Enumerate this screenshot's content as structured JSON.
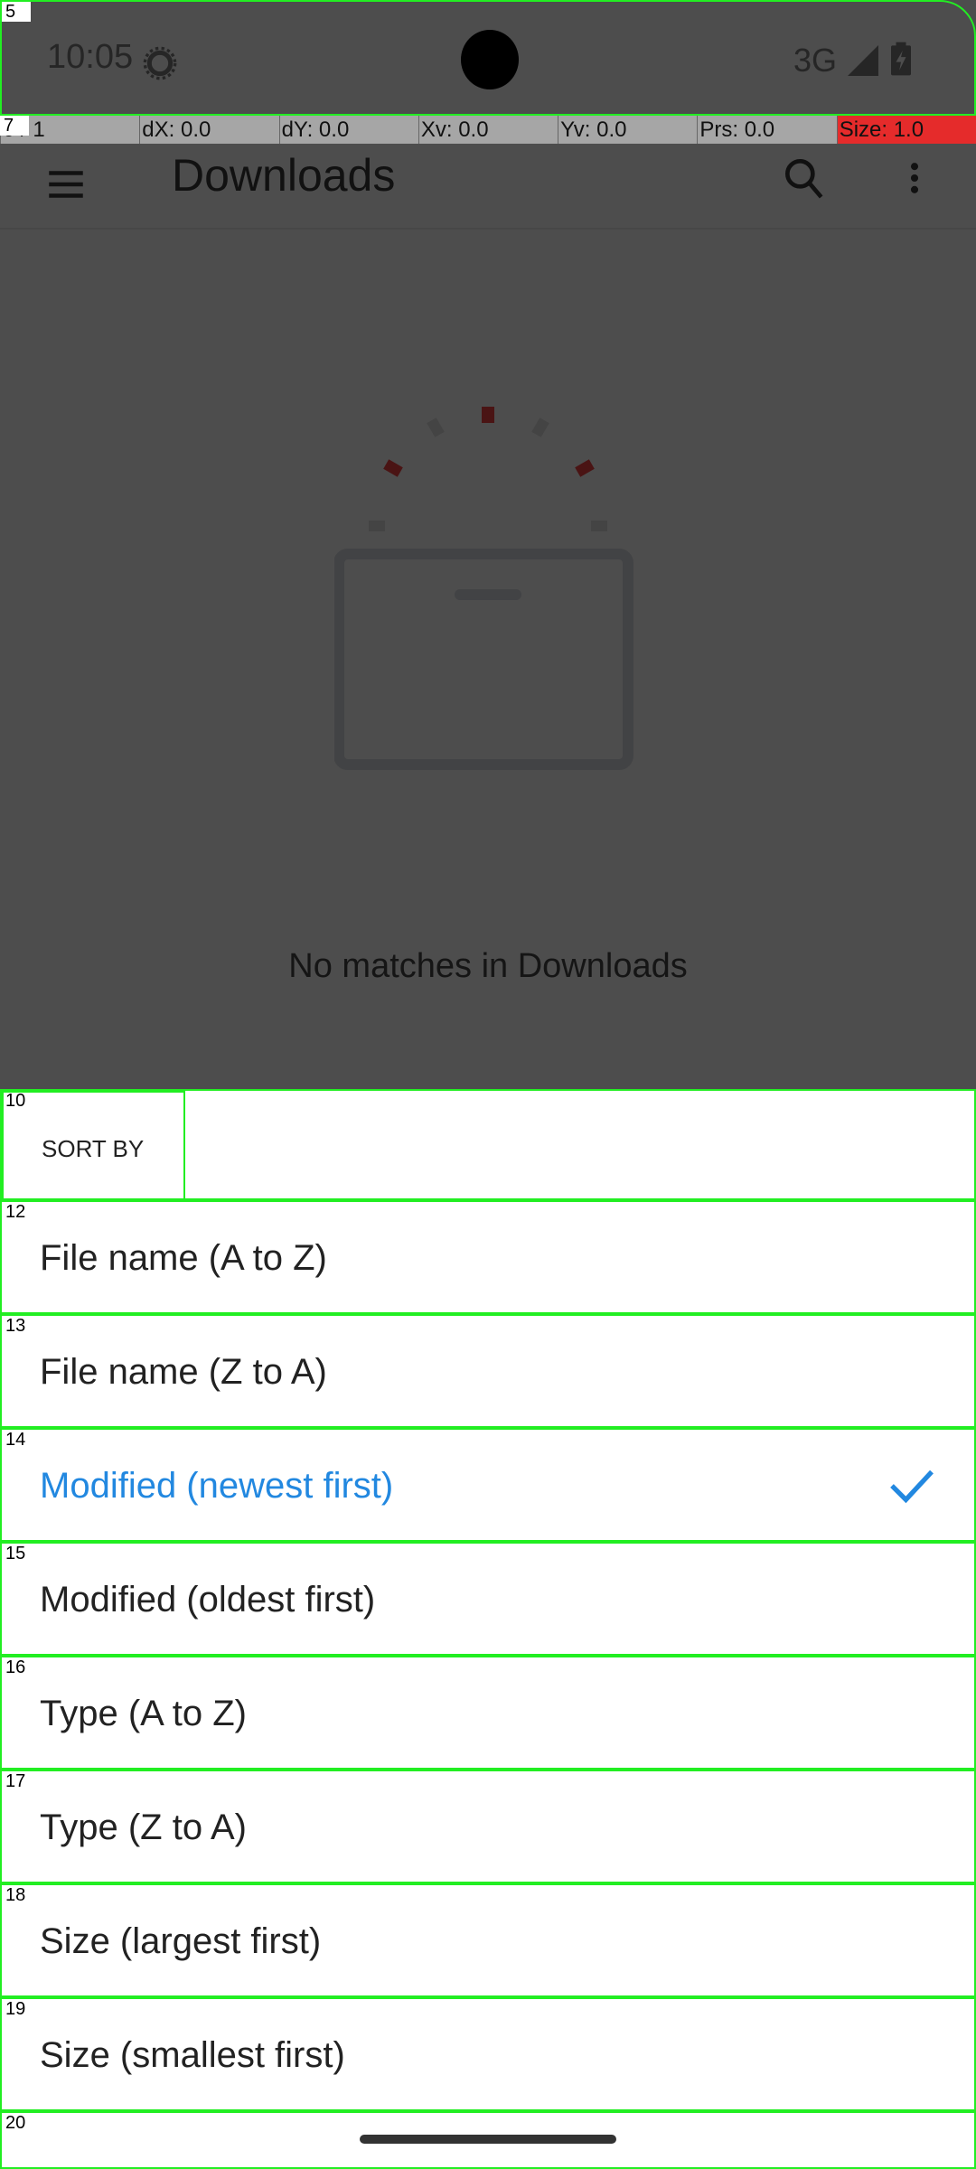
{
  "overlay_ids": [
    "5",
    "7",
    "10",
    "12",
    "13",
    "14",
    "15",
    "16",
    "17",
    "18",
    "19",
    "20"
  ],
  "status_bar": {
    "time": "10:05",
    "network": "3G",
    "icons": [
      "settings-gear-icon",
      "signal-icon",
      "battery-charging-icon"
    ]
  },
  "debug_bar": [
    "0 / 1",
    "dX: 0.0",
    "dY: 0.0",
    "Xv: 0.0",
    "Yv: 0.0",
    "Prs: 0.0",
    "Size: 1.0"
  ],
  "toolbar": {
    "title": "Downloads",
    "icons": [
      "menu-icon",
      "search-icon",
      "more-vert-icon"
    ]
  },
  "empty_state": {
    "message": "No matches in Downloads"
  },
  "sort_sheet": {
    "header": "SORT BY",
    "options": [
      {
        "label": "File name (A to Z)",
        "selected": false
      },
      {
        "label": "File name (Z to A)",
        "selected": false
      },
      {
        "label": "Modified (newest first)",
        "selected": true
      },
      {
        "label": "Modified (oldest first)",
        "selected": false
      },
      {
        "label": "Type (A to Z)",
        "selected": false
      },
      {
        "label": "Type (Z to A)",
        "selected": false
      },
      {
        "label": "Size (largest first)",
        "selected": false
      },
      {
        "label": "Size (smallest first)",
        "selected": false
      }
    ],
    "accent_color": "#2288e0"
  }
}
